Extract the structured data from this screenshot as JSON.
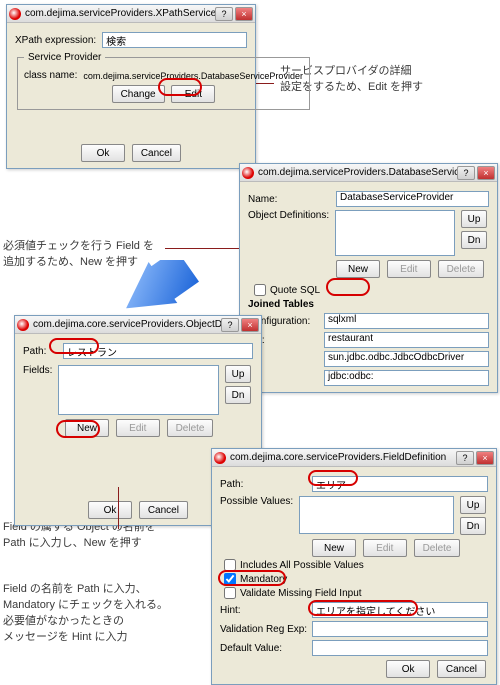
{
  "anno": {
    "a1": "サービスプロバイダの詳細\n設定をするため、Edit を押す",
    "a2": "必須値チェックを行う Field を\n追加するため、New を押す",
    "a3": "Field の属する Object の名前を\nPath に入力し、New を押す",
    "a4": "Field の名前を Path に入力、\nMandatory にチェックを入れる。\n必要値がなかったときの\nメッセージを Hint に入力"
  },
  "common": {
    "ok": "Ok",
    "cancel": "Cancel",
    "new": "New",
    "edit": "Edit",
    "delete": "Delete",
    "change": "Change",
    "up": "Up",
    "dn": "Dn"
  },
  "dlg1": {
    "title": "com.dejima.serviceProviders.XPathServiceProviderMatcher",
    "xpath_label": "XPath expression:",
    "xpath_value": "検索",
    "sp_legend": "Service Provider",
    "classname_label": "class name:",
    "classname_value": "com.dejima.serviceProviders.DatabaseServiceProvider"
  },
  "dlg2": {
    "title": "com.dejima.serviceProviders.DatabaseServiceProvider",
    "name_label": "Name:",
    "name_value": "DatabaseServiceProvider",
    "objdef_label": "Object Definitions:",
    "quote_sql": "Quote SQL",
    "joined_tables": "Joined Tables",
    "configuration_label": "Configuration:",
    "configuration_value": "sqlxml",
    "source_label": "rce:",
    "source_value": "restaurant",
    "driver_value": "sun.jdbc.odbc.JdbcOdbcDriver",
    "url_value": "jdbc:odbc:"
  },
  "dlg3": {
    "title": "com.dejima.core.serviceProviders.ObjectDefinition",
    "path_label": "Path:",
    "path_value": "レストラン",
    "fields_label": "Fields:"
  },
  "dlg4": {
    "title": "com.dejima.core.serviceProviders.FieldDefinition",
    "path_label": "Path:",
    "path_value": "エリア",
    "pv_label": "Possible Values:",
    "inc_all": "Includes All Possible Values",
    "mandatory": "Mandatory",
    "validate_missing": "Validate Missing Field Input",
    "hint_label": "Hint:",
    "hint_value": "エリアを指定してください",
    "regex_label": "Validation Reg Exp:",
    "default_label": "Default Value:"
  }
}
